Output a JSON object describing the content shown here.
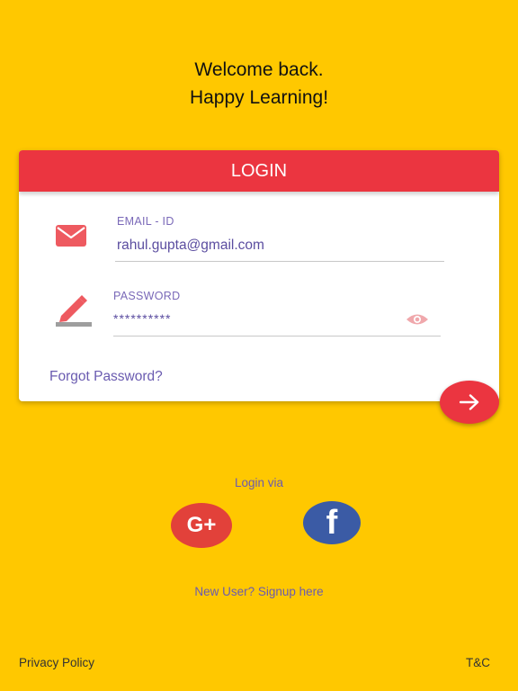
{
  "welcome": {
    "line1": "Welcome back.",
    "line2": "Happy Learning!"
  },
  "login_card": {
    "title": "LOGIN",
    "email": {
      "label": "EMAIL - ID",
      "value": "rahul.gupta@gmail.com",
      "icon": "envelope-icon"
    },
    "password": {
      "label": "PASSWORD",
      "value": "**********",
      "icon": "pencil-icon",
      "toggle_icon": "eye-icon"
    },
    "forgot_label": "Forgot Password?",
    "submit_icon": "arrow-right-icon"
  },
  "social": {
    "label": "Login via",
    "google_label": "G+",
    "facebook_label": "f"
  },
  "signup_label": "New User? Signup here",
  "footer": {
    "privacy_label": "Privacy Policy",
    "tc_label": "T&C"
  },
  "colors": {
    "background": "#FFC800",
    "accent_red": "#EB3540",
    "link_purple": "#6A5BB0",
    "google_red": "#E2413A",
    "facebook_blue": "#3B5BA5"
  }
}
